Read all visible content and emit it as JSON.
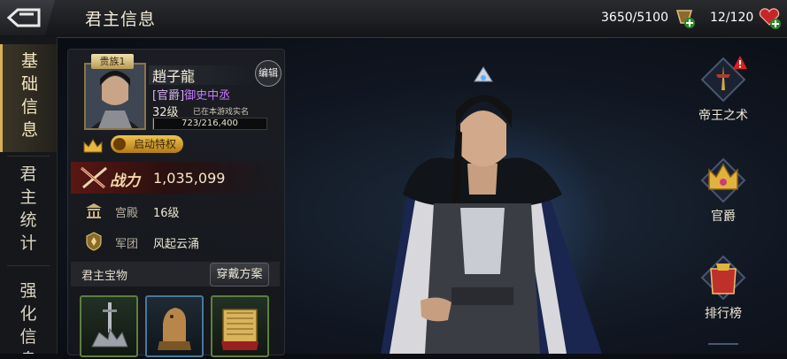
{
  "header": {
    "title": "君主信息",
    "resources": [
      {
        "value": "3650/5100",
        "icon": "troop-plus-icon"
      },
      {
        "value": "12/120",
        "icon": "heart-plus-icon"
      }
    ]
  },
  "sidebar": {
    "tabs": [
      {
        "label": "基础信息",
        "active": true
      },
      {
        "label": "君主统计",
        "active": false
      },
      {
        "label": "强化信息",
        "active": false
      }
    ]
  },
  "profile": {
    "rank_tag": "贵族1",
    "name": "趙子龍",
    "edit_label": "编辑",
    "official_prefix": "[官爵]",
    "official_title": "御史中丞",
    "level": "32级",
    "verified_text": "已在本游戏实名",
    "exp_text": "723/216,400",
    "exp_fraction": 0.0033,
    "privilege_label": "启动特权",
    "power_label": "战力",
    "power_value": "1,035,099",
    "stats": [
      {
        "label": "宫殿",
        "value": "16级"
      },
      {
        "label": "军团",
        "value": "风起云涌"
      }
    ],
    "treasure_title": "君主宝物",
    "wear_label": "穿戴方案"
  },
  "right_menu": [
    {
      "label": "帝王之术",
      "icon": "emperor-art-icon",
      "alert": true
    },
    {
      "label": "官爵",
      "icon": "official-crown-icon",
      "alert": false
    },
    {
      "label": "排行榜",
      "icon": "ranking-icon",
      "alert": false
    }
  ],
  "colors": {
    "gold": "#d7b05a",
    "official_purple": "#c77bff",
    "power_red": "#5a1713"
  }
}
